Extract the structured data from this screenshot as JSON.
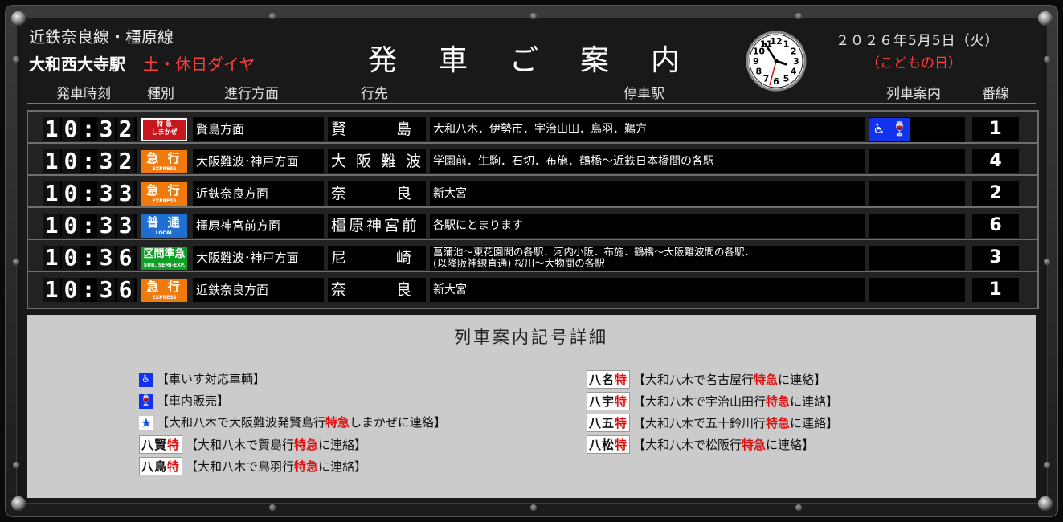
{
  "header": {
    "line_name": "近鉄奈良線・橿原線",
    "station": "大和西大寺駅",
    "day_type": "土・休日ダイヤ",
    "title_chars": [
      "発",
      "車",
      "ご",
      "案",
      "内"
    ],
    "date": "２０２６年5月5日（火）",
    "holiday": "（こどもの日）"
  },
  "columns": {
    "time": "発車時刻",
    "type": "種別",
    "direction": "進行方面",
    "destination": "行先",
    "stops": "停車駅",
    "info": "列車案内",
    "track": "番線"
  },
  "trains": [
    {
      "time": [
        "1",
        "0",
        ":",
        "3",
        "2"
      ],
      "type_main": "特 急",
      "type_sub": "しまかぜ",
      "type_style": "ltd",
      "direction": "賢島方面",
      "destination": "賢　　島",
      "stops": "大和八木．伊勢市．宇治山田．鳥羽．鵜方",
      "symbols": [
        "wheelchair-icon",
        "vending-icon"
      ],
      "track": "1"
    },
    {
      "time": [
        "1",
        "0",
        ":",
        "3",
        "2"
      ],
      "type_main": "急 行",
      "type_sub": "EXPRESS",
      "type_style": "exp",
      "direction": "大阪難波･神戸方面",
      "destination": "大 阪 難 波",
      "stops": "学園前．生駒．石切．布施．鶴橋～近鉄日本橋間の各駅",
      "symbols": [],
      "track": "4"
    },
    {
      "time": [
        "1",
        "0",
        ":",
        "3",
        "3"
      ],
      "type_main": "急 行",
      "type_sub": "EXPRESS",
      "type_style": "exp",
      "direction": "近鉄奈良方面",
      "destination": "奈　　良",
      "stops": "新大宮",
      "symbols": [],
      "track": "2"
    },
    {
      "time": [
        "1",
        "0",
        ":",
        "3",
        "3"
      ],
      "type_main": "普 通",
      "type_sub": "LOCAL",
      "type_style": "loc",
      "direction": "橿原神宮前方面",
      "destination": "橿原神宮前",
      "stops": "各駅にとまります",
      "symbols": [],
      "track": "6"
    },
    {
      "time": [
        "1",
        "0",
        ":",
        "3",
        "6"
      ],
      "type_main": "区間準急",
      "type_sub": "SUB. SEMI-EXP.",
      "type_style": "semi",
      "direction": "大阪難波･神戸方面",
      "destination": "尼　　崎",
      "stops": "菖蒲池～東花園間の各駅．河内小阪．布施．鶴橋～大阪難波間の各駅．\n(以降阪神線直通) 桜川～大物間の各駅",
      "symbols": [],
      "track": "3"
    },
    {
      "time": [
        "1",
        "0",
        ":",
        "3",
        "6"
      ],
      "type_main": "急 行",
      "type_sub": "EXPRESS",
      "type_style": "exp",
      "direction": "近鉄奈良方面",
      "destination": "奈　　良",
      "stops": "新大宮",
      "symbols": [],
      "track": "1"
    }
  ],
  "legend": {
    "title": "列車案内記号詳細",
    "left": [
      {
        "icon": "wheelchair-icon",
        "glyph": "♿",
        "text_before": "【車いす対応車輌】",
        "red": "",
        "text_after": ""
      },
      {
        "icon": "vending-icon",
        "glyph": "🍷",
        "text_before": "【車内販売】",
        "red": "",
        "text_after": ""
      },
      {
        "icon": "star-icon",
        "glyph": "★",
        "text_before": "【大和八木で大阪難波発賢島行",
        "red": "特急",
        "text_after": "しまかぜに連絡】"
      },
      {
        "tag": "八賢",
        "tag_red": "特",
        "text_before": "【大和八木で賢島行",
        "red": "特急",
        "text_after": "に連絡】"
      },
      {
        "tag": "八鳥",
        "tag_red": "特",
        "text_before": "【大和八木で鳥羽行",
        "red": "特急",
        "text_after": "に連絡】"
      }
    ],
    "right": [
      {
        "tag": "八名",
        "tag_red": "特",
        "text_before": "【大和八木で名古屋行",
        "red": "特急",
        "text_after": "に連絡】"
      },
      {
        "tag": "八宇",
        "tag_red": "特",
        "text_before": "【大和八木で宇治山田行",
        "red": "特急",
        "text_after": "に連絡】"
      },
      {
        "tag": "八五",
        "tag_red": "特",
        "text_before": "【大和八木で五十鈴川行",
        "red": "特急",
        "text_after": "に連絡】"
      },
      {
        "tag": "八松",
        "tag_red": "特",
        "text_before": "【大和八木で松阪行",
        "red": "特急",
        "text_after": "に連絡】"
      }
    ]
  },
  "clock": {
    "numbers": [
      "12",
      "1",
      "2",
      "3",
      "4",
      "5",
      "6",
      "7",
      "8",
      "9",
      "10",
      "11"
    ]
  },
  "colors": {
    "limited": "#c8161e",
    "express": "#f07a0c",
    "local": "#1e6fd0",
    "semi": "#10a025",
    "accent_red": "#ff3b3b"
  }
}
